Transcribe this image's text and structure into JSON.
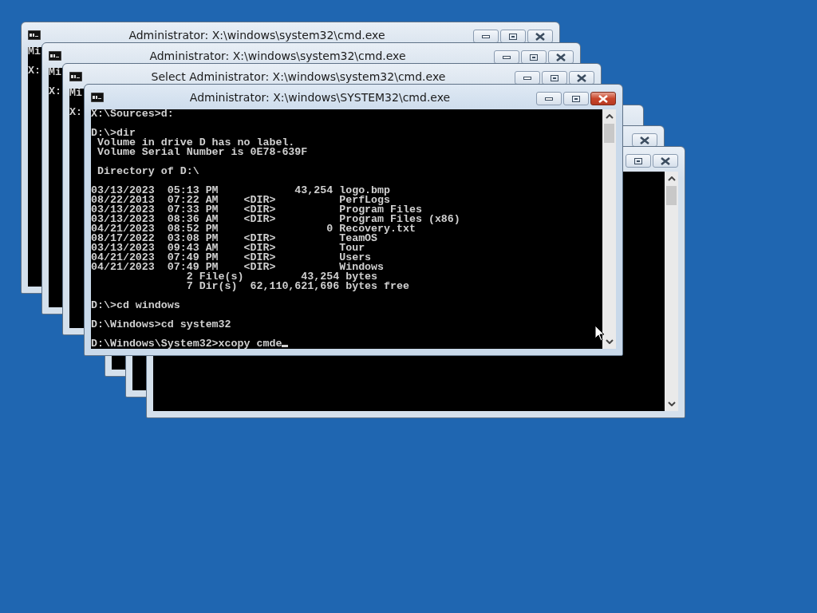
{
  "windows": [
    {
      "title": "Administrator: X:\\windows\\system32\\cmd.exe",
      "active": false,
      "console": [
        [
          "Mi"
        ],
        [
          "X:"
        ]
      ]
    },
    {
      "title": "Administrator: X:\\windows\\system32\\cmd.exe",
      "active": false,
      "console": [
        [
          "Mi"
        ],
        [
          "X:"
        ]
      ]
    },
    {
      "title": "Select Administrator: X:\\windows\\system32\\cmd.exe",
      "active": false,
      "console": [
        [
          "Mi"
        ],
        [
          "X:"
        ]
      ]
    },
    {
      "title": "Administrator: X:\\windows\\SYSTEM32\\cmd.exe",
      "active": true,
      "console": [
        [
          "X:\\Sources>d:"
        ],
        [
          "D:\\>dir",
          " Volume in drive D has no label.",
          " Volume Serial Number is 0E78-639F"
        ],
        [
          " Directory of D:\\"
        ],
        [
          "03/13/2023  05:13 PM            43,254 logo.bmp",
          "08/22/2013  07:22 AM    <DIR>          PerfLogs",
          "03/13/2023  07:33 PM    <DIR>          Program Files",
          "03/13/2023  08:36 AM    <DIR>          Program Files (x86)",
          "04/21/2023  08:52 PM                 0 Recovery.txt",
          "08/17/2022  03:08 PM    <DIR>          TeamOS",
          "03/13/2023  09:43 AM    <DIR>          Tour",
          "04/21/2023  07:49 PM    <DIR>          Users",
          "04/21/2023  07:49 PM    <DIR>          Windows",
          "               2 File(s)         43,254 bytes",
          "               7 Dir(s)  62,110,621,696 bytes free"
        ],
        [
          "D:\\>cd windows"
        ],
        [
          "D:\\Windows>cd system32"
        ],
        [
          "D:\\Windows\\System32>xcopy cmde"
        ]
      ]
    },
    {
      "active": false
    },
    {
      "active": false
    },
    {
      "active": false
    }
  ]
}
